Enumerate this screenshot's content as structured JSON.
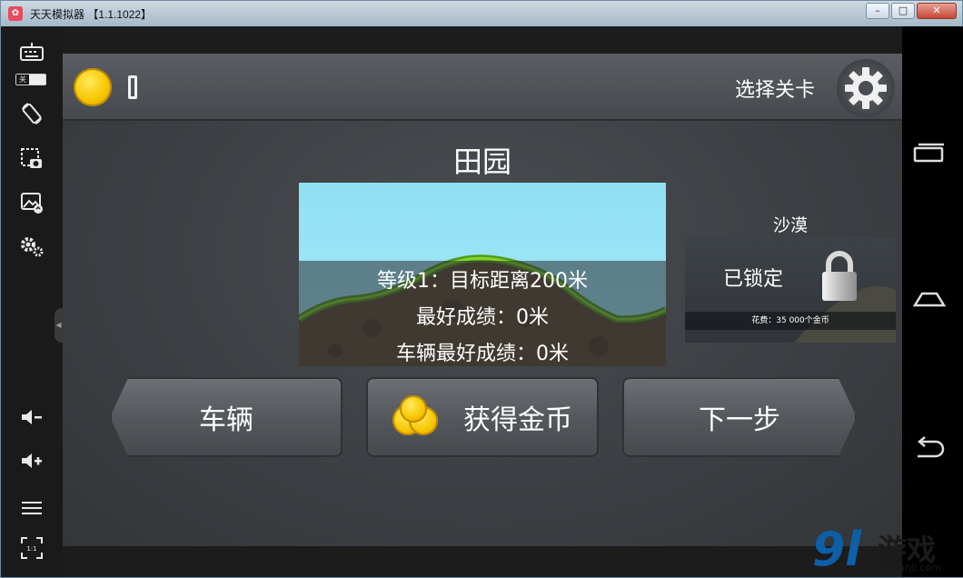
{
  "window": {
    "title": "天天模拟器 【1.1.1022】",
    "app_icon": "tiantian-emulator-icon",
    "controls": [
      "minimize",
      "maximize",
      "close"
    ]
  },
  "sidebar": {
    "toggle_label": "关",
    "tools": [
      "keyboard-icon",
      "rotate-icon",
      "screenshot-icon",
      "image-icon",
      "settings-icon",
      "volume-down-icon",
      "volume-up-icon",
      "menu-icon",
      "fullscreen-icon"
    ],
    "fullscreen_label": "1:1"
  },
  "game": {
    "select_level": "选择关卡",
    "current_level": {
      "name": "田园",
      "line1": "等级1：目标距离200米",
      "line2": "最好成绩：0米",
      "line3": "车辆最好成绩：0米"
    },
    "next_level": {
      "name": "沙漠",
      "status": "已锁定",
      "cost": "花费：35 000个金币"
    },
    "buttons": {
      "vehicle": "车辆",
      "get_coins": "获得金币",
      "next": "下一步"
    }
  },
  "watermark": {
    "logo_digits": "9l",
    "brand": "游戏",
    "site": "91danji.com"
  },
  "colors": {
    "coin": "#f7c600",
    "watermark_blue": "#0d5fa8"
  }
}
